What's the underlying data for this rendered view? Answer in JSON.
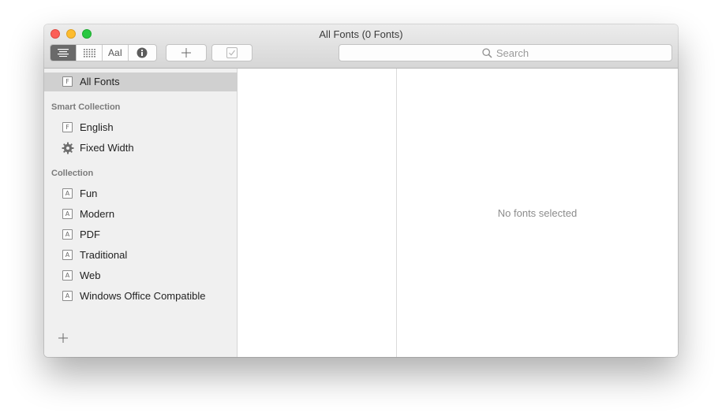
{
  "window": {
    "title": "All Fonts (0 Fonts)"
  },
  "toolbar": {
    "view_segments": [
      {
        "icon": "list-view-icon",
        "active": true
      },
      {
        "icon": "grid-view-icon",
        "active": false
      },
      {
        "icon": "sample-view-icon",
        "label": "AaI",
        "active": false
      },
      {
        "icon": "info-icon",
        "active": false
      }
    ],
    "add_icon": "plus-icon",
    "validate_icon": "checkbox-check-icon",
    "search": {
      "placeholder": "Search",
      "icon": "search-icon"
    }
  },
  "sidebar": {
    "all_fonts": {
      "label": "All Fonts",
      "icon_letter": "F"
    },
    "smart_collection_heading": "Smart Collection",
    "smart_collections": [
      {
        "label": "English",
        "icon": "font-collection-icon",
        "icon_letter": "F"
      },
      {
        "label": "Fixed Width",
        "icon": "gear-icon"
      }
    ],
    "collection_heading": "Collection",
    "collections": [
      {
        "label": "Fun",
        "icon_letter": "A"
      },
      {
        "label": "Modern",
        "icon_letter": "A"
      },
      {
        "label": "PDF",
        "icon_letter": "A"
      },
      {
        "label": "Traditional",
        "icon_letter": "A"
      },
      {
        "label": "Web",
        "icon_letter": "A"
      },
      {
        "label": "Windows Office Compatible",
        "icon_letter": "A"
      }
    ],
    "add_icon": "plus-icon"
  },
  "detail": {
    "empty_message": "No fonts selected"
  }
}
